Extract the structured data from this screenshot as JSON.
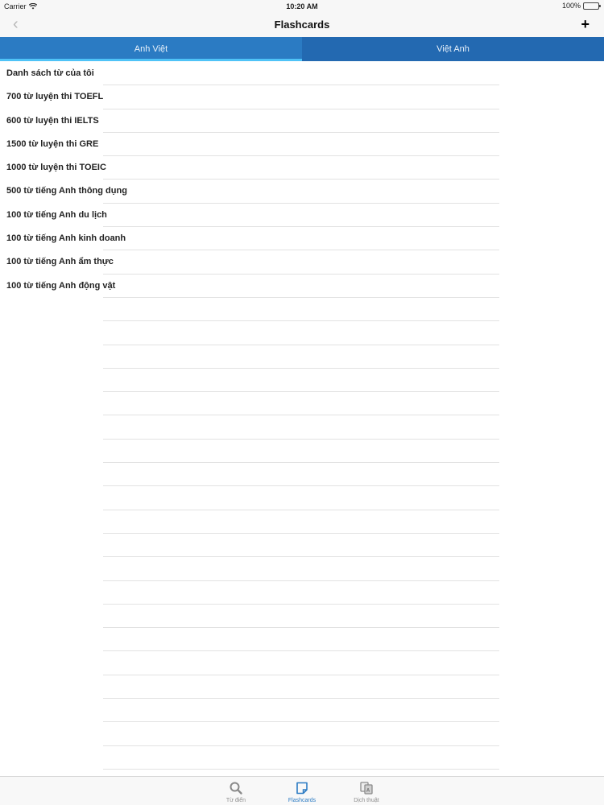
{
  "status_bar": {
    "carrier": "Carrier",
    "time": "10:20 AM",
    "battery": "100%",
    "wifi_icon": "wifi-icon",
    "battery_icon": "battery-icon"
  },
  "nav": {
    "back_icon": "chevron-left-icon",
    "title": "Flashcards",
    "add_icon": "plus-icon"
  },
  "tabs": [
    {
      "label": "Anh Việt",
      "active": true
    },
    {
      "label": "Việt Anh",
      "active": false
    }
  ],
  "list": [
    "Danh sách từ của tôi",
    "700 từ luyện thi TOEFL",
    "600 từ luyện thi IELTS",
    "1500 từ luyện thi GRE",
    "1000 từ luyện thi TOEIC",
    "500 từ tiếng Anh thông dụng",
    "100 từ tiếng Anh du lịch",
    "100 từ tiếng Anh kinh doanh",
    "100 từ tiếng Anh ẩm thực",
    "100 từ tiếng Anh động vật"
  ],
  "tab_bar": [
    {
      "label": "Từ điển",
      "icon": "search-icon",
      "active": false
    },
    {
      "label": "Flashcards",
      "icon": "flashcard-icon",
      "active": true
    },
    {
      "label": "Dịch thuật",
      "icon": "translate-icon",
      "active": false
    }
  ],
  "colors": {
    "accent": "#2b7bc3",
    "tab_dark": "#2369b1",
    "tab_indicator": "#4fc3f7"
  }
}
